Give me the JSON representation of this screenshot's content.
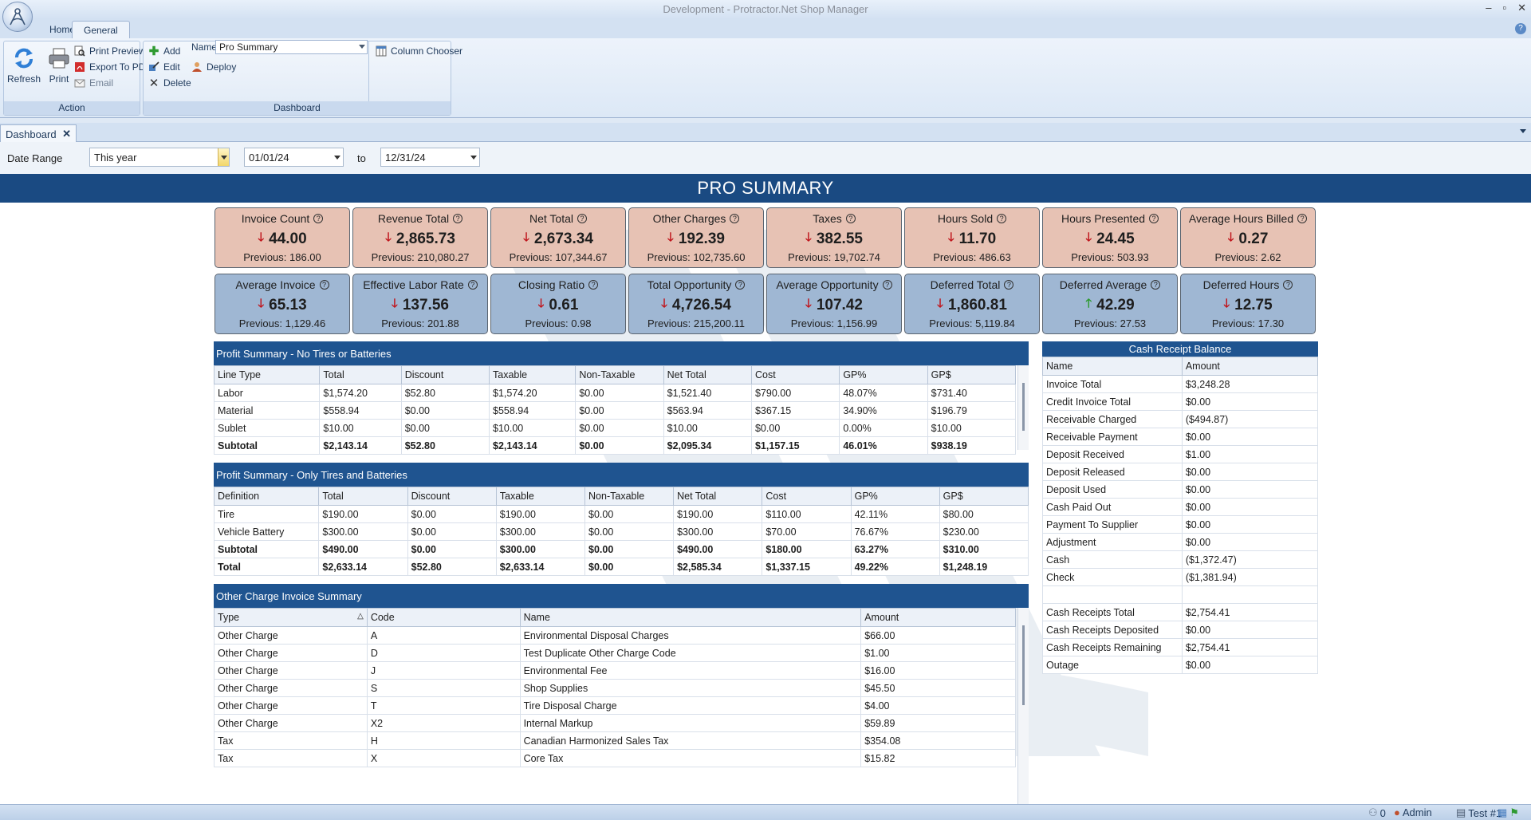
{
  "window": {
    "title": "Development - Protractor.Net Shop Manager",
    "min": "‒",
    "max": "▫",
    "close": "✕"
  },
  "ribbon": {
    "tabs": [
      "Home",
      "General"
    ],
    "action": {
      "label": "Action",
      "refresh": "Refresh",
      "print": "Print",
      "print_preview": "Print Preview",
      "export_pdf": "Export To PDF",
      "email": "Email"
    },
    "dashboard": {
      "label": "Dashboard",
      "add": "Add",
      "edit": "Edit",
      "delete": "Delete",
      "name_label": "Name",
      "name_value": "Pro Summary",
      "deploy": "Deploy",
      "column_chooser": "Column Chooser"
    }
  },
  "doc_tab": {
    "label": "Dashboard",
    "close": "✕"
  },
  "filter": {
    "date_range_label": "Date Range",
    "range_value": "This year",
    "from_date": "01/01/24",
    "to_label": "to",
    "to_date": "12/31/24"
  },
  "header": {
    "title": "PRO SUMMARY"
  },
  "kpis": [
    {
      "title": "Invoice Count",
      "value": "44.00",
      "previous": "Previous: 186.00",
      "trend": "down",
      "color": "#e7c2b4"
    },
    {
      "title": "Revenue Total",
      "value": "2,865.73",
      "previous": "Previous: 210,080.27",
      "trend": "down",
      "color": "#e7c2b4"
    },
    {
      "title": "Net Total",
      "value": "2,673.34",
      "previous": "Previous: 107,344.67",
      "trend": "down",
      "color": "#e7c2b4"
    },
    {
      "title": "Other Charges",
      "value": "192.39",
      "previous": "Previous: 102,735.60",
      "trend": "down",
      "color": "#e7c2b4"
    },
    {
      "title": "Taxes",
      "value": "382.55",
      "previous": "Previous: 19,702.74",
      "trend": "down",
      "color": "#e7c2b4"
    },
    {
      "title": "Hours Sold",
      "value": "11.70",
      "previous": "Previous: 486.63",
      "trend": "down",
      "color": "#e7c2b4"
    },
    {
      "title": "Hours Presented",
      "value": "24.45",
      "previous": "Previous: 503.93",
      "trend": "down",
      "color": "#e7c2b4"
    },
    {
      "title": "Average Hours Billed",
      "value": "0.27",
      "previous": "Previous: 2.62",
      "trend": "down",
      "color": "#e7c2b4"
    },
    {
      "title": "Average Invoice",
      "value": "65.13",
      "previous": "Previous: 1,129.46",
      "trend": "down",
      "color": "#9fb7d3"
    },
    {
      "title": "Effective Labor Rate",
      "value": "137.56",
      "previous": "Previous: 201.88",
      "trend": "down",
      "color": "#9fb7d3"
    },
    {
      "title": "Closing Ratio",
      "value": "0.61",
      "previous": "Previous: 0.98",
      "trend": "down",
      "color": "#9fb7d3"
    },
    {
      "title": "Total Opportunity",
      "value": "4,726.54",
      "previous": "Previous: 215,200.11",
      "trend": "down",
      "color": "#9fb7d3"
    },
    {
      "title": "Average Opportunity",
      "value": "107.42",
      "previous": "Previous: 1,156.99",
      "trend": "down",
      "color": "#9fb7d3"
    },
    {
      "title": "Deferred Total",
      "value": "1,860.81",
      "previous": "Previous: 5,119.84",
      "trend": "down",
      "color": "#9fb7d3"
    },
    {
      "title": "Deferred Average",
      "value": "42.29",
      "previous": "Previous: 27.53",
      "trend": "up",
      "color": "#9fb7d3"
    },
    {
      "title": "Deferred Hours",
      "value": "12.75",
      "previous": "Previous: 17.30",
      "trend": "down",
      "color": "#9fb7d3"
    }
  ],
  "profit_no_tires": {
    "title": "Profit Summary - No Tires or Batteries",
    "columns": [
      "Line Type",
      "Total",
      "Discount",
      "Taxable",
      "Non-Taxable",
      "Net Total",
      "Cost",
      "GP%",
      "GP$"
    ],
    "rows": [
      [
        "Labor",
        "$1,574.20",
        "$52.80",
        "$1,574.20",
        "$0.00",
        "$1,521.40",
        "$790.00",
        "48.07%",
        "$731.40"
      ],
      [
        "Material",
        "$558.94",
        "$0.00",
        "$558.94",
        "$0.00",
        "$563.94",
        "$367.15",
        "34.90%",
        "$196.79"
      ],
      [
        "Sublet",
        "$10.00",
        "$0.00",
        "$10.00",
        "$0.00",
        "$10.00",
        "$0.00",
        "0.00%",
        "$10.00"
      ],
      [
        "Subtotal",
        "$2,143.14",
        "$52.80",
        "$2,143.14",
        "$0.00",
        "$2,095.34",
        "$1,157.15",
        "46.01%",
        "$938.19"
      ]
    ]
  },
  "profit_tires": {
    "title": "Profit Summary - Only Tires and Batteries",
    "columns": [
      "Definition",
      "Total",
      "Discount",
      "Taxable",
      "Non-Taxable",
      "Net Total",
      "Cost",
      "GP%",
      "GP$"
    ],
    "rows": [
      [
        "Tire",
        "$190.00",
        "$0.00",
        "$190.00",
        "$0.00",
        "$190.00",
        "$110.00",
        "42.11%",
        "$80.00"
      ],
      [
        "Vehicle Battery",
        "$300.00",
        "$0.00",
        "$300.00",
        "$0.00",
        "$300.00",
        "$70.00",
        "76.67%",
        "$230.00"
      ],
      [
        "Subtotal",
        "$490.00",
        "$0.00",
        "$300.00",
        "$0.00",
        "$490.00",
        "$180.00",
        "63.27%",
        "$310.00"
      ],
      [
        "Total",
        "$2,633.14",
        "$52.80",
        "$2,633.14",
        "$0.00",
        "$2,585.34",
        "$1,337.15",
        "49.22%",
        "$1,248.19"
      ]
    ]
  },
  "other_charges": {
    "title": "Other Charge Invoice Summary",
    "columns": [
      "Type",
      "Code",
      "Name",
      "Amount"
    ],
    "sort_indicator": "△",
    "rows": [
      [
        "Other Charge",
        "A",
        "Environmental Disposal Charges",
        "$66.00"
      ],
      [
        "Other Charge",
        "D",
        "Test Duplicate Other Charge Code",
        "$1.00"
      ],
      [
        "Other Charge",
        "J",
        "Environmental Fee",
        "$16.00"
      ],
      [
        "Other Charge",
        "S",
        "Shop Supplies",
        "$45.50"
      ],
      [
        "Other Charge",
        "T",
        "Tire Disposal Charge",
        "$4.00"
      ],
      [
        "Other Charge",
        "X2",
        "Internal Markup",
        "$59.89"
      ],
      [
        "Tax",
        "H",
        "Canadian Harmonized Sales Tax",
        "$354.08"
      ],
      [
        "Tax",
        "X",
        "Core Tax",
        "$15.82"
      ]
    ]
  },
  "cash_receipt": {
    "title": "Cash Receipt Balance",
    "columns": [
      "Name",
      "Amount"
    ],
    "rows": [
      [
        "Invoice Total",
        "$3,248.28"
      ],
      [
        "Credit Invoice Total",
        "$0.00"
      ],
      [
        "Receivable Charged",
        "($494.87)"
      ],
      [
        "Receivable Payment",
        "$0.00"
      ],
      [
        "Deposit Received",
        "$1.00"
      ],
      [
        "Deposit Released",
        "$0.00"
      ],
      [
        "Deposit Used",
        "$0.00"
      ],
      [
        "Cash Paid Out",
        "$0.00"
      ],
      [
        "Payment To Supplier",
        "$0.00"
      ],
      [
        "Adjustment",
        "$0.00"
      ],
      [
        "Cash",
        "($1,372.47)"
      ],
      [
        "Check",
        "($1,381.94)"
      ],
      [
        "",
        ""
      ],
      [
        "Cash Receipts Total",
        "$2,754.41"
      ],
      [
        "Cash Receipts Deposited",
        "$0.00"
      ],
      [
        "Cash Receipts Remaining",
        "$2,754.41"
      ],
      [
        "Outage",
        "$0.00"
      ]
    ]
  },
  "status": {
    "count": "0",
    "user": "Admin",
    "location": "Test #1"
  }
}
